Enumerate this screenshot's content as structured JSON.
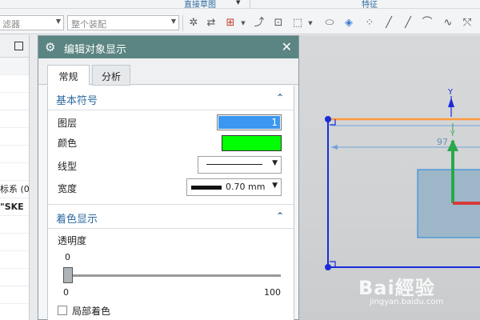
{
  "ribbon": {
    "group_sketch": "直接草图",
    "group_feature": "特征"
  },
  "toolbar": {
    "filter_placeholder": "滤器",
    "assembly_scope": "整个装配"
  },
  "navigator": {
    "rows": [
      "",
      "",
      "",
      "",
      "",
      "",
      "",
      "标系 (0)",
      "\"SKE",
      "",
      "",
      "",
      "",
      "",
      "",
      ""
    ]
  },
  "dialog": {
    "title": "编辑对象显示",
    "tabs": [
      "常规",
      "分析"
    ],
    "active_tab": "常规",
    "section_basic": "基本符号",
    "layer_label": "图层",
    "layer_value": "1",
    "color_label": "颜色",
    "color_value": "#00ff00",
    "linetype_label": "线型",
    "width_label": "宽度",
    "width_value": "0.70 mm",
    "section_shading": "着色显示",
    "transparency_label": "透明度",
    "transparency_value": "0",
    "slider_min": "0",
    "slider_max": "100",
    "partial_shading_label": "局部着色"
  },
  "graphics": {
    "dimension_value": "97"
  },
  "watermark": {
    "main": "Bai經验",
    "sub": "jingyan.baidu.com"
  }
}
